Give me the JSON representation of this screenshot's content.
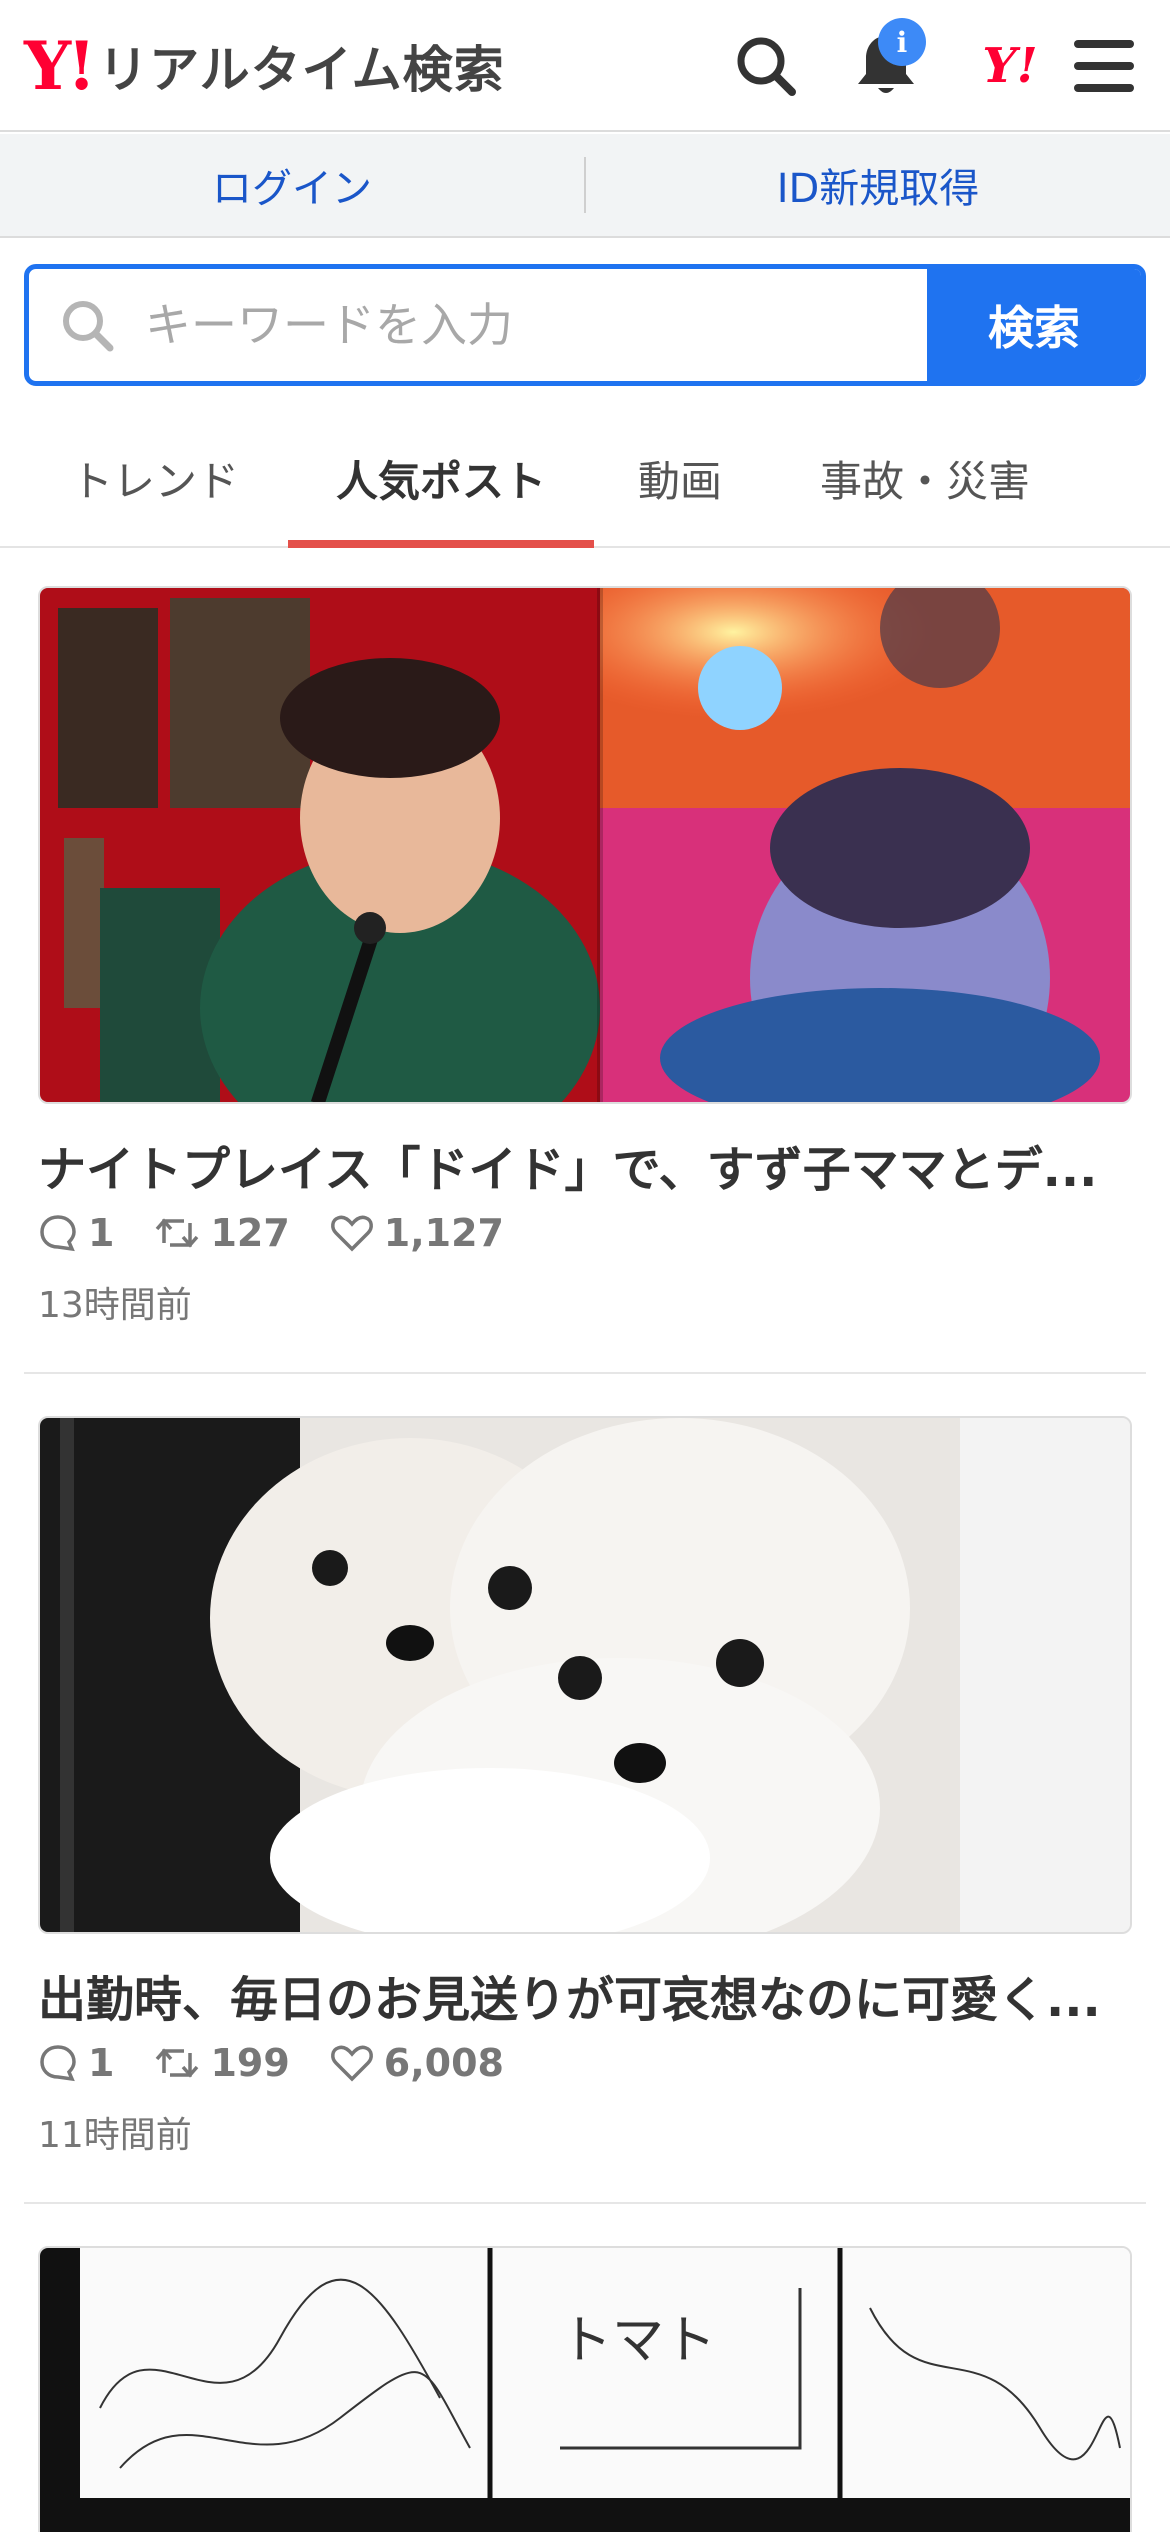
{
  "header": {
    "logo_mark": "Y!",
    "logo_text": "リアルタイム検索",
    "bell_badge": "i",
    "yahoo_mark": "Y!"
  },
  "loginbar": {
    "login": "ログイン",
    "register": "ID新規取得"
  },
  "search": {
    "placeholder": "キーワードを入力",
    "button": "検索"
  },
  "tabs": [
    {
      "label": "トレンド",
      "active": false
    },
    {
      "label": "人気ポスト",
      "active": true
    },
    {
      "label": "動画",
      "active": false
    },
    {
      "label": "事故・災害",
      "active": false
    }
  ],
  "posts": [
    {
      "title": "ナイトプレイス「ドイド」で、すず子ママとデ...",
      "replies": "1",
      "reposts": "127",
      "likes": "1,127",
      "time": "13時間前"
    },
    {
      "title": "出勤時、毎日のお見送りが可哀想なのに可愛く...",
      "replies": "1",
      "reposts": "199",
      "likes": "6,008",
      "time": "11時間前"
    },
    {
      "image_text": "トマト"
    }
  ],
  "colors": {
    "brand_red": "#ff0033",
    "accent_blue": "#1f73f0",
    "link_blue": "#1a56c9",
    "tab_underline": "#e4504a",
    "badge_blue": "#3d8af7"
  }
}
